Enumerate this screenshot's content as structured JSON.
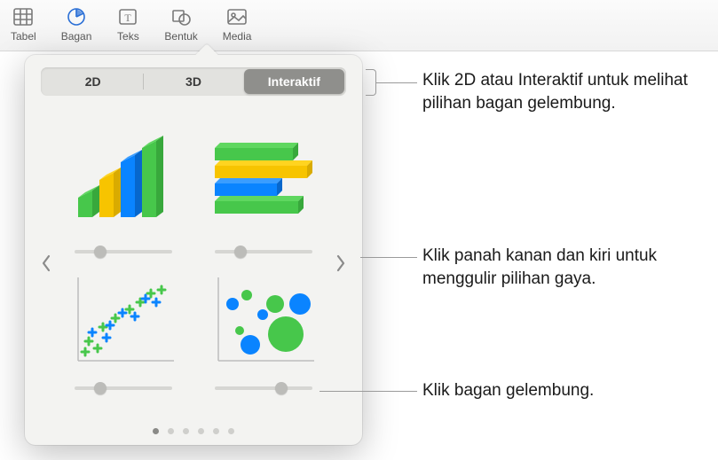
{
  "toolbar": {
    "items": [
      {
        "label": "Tabel"
      },
      {
        "label": "Bagan"
      },
      {
        "label": "Teks"
      },
      {
        "label": "Bentuk"
      },
      {
        "label": "Media"
      }
    ]
  },
  "popover": {
    "tabs": {
      "t2d": "2D",
      "t3d": "3D",
      "interactive": "Interaktif"
    },
    "page_count": 6,
    "active_page": 0,
    "sliders": {
      "pos1": 25,
      "pos2": 25,
      "pos3": 25,
      "pos4": 70
    }
  },
  "callouts": {
    "c1": "Klik 2D atau Interaktif untuk melihat pilihan bagan gelembung.",
    "c2": "Klik panah kanan dan kiri untuk menggulir pilihan gaya.",
    "c3": "Klik bagan gelembung."
  },
  "colors": {
    "green": "#47c74b",
    "yellow": "#f7c400",
    "blue": "#0a84ff"
  }
}
